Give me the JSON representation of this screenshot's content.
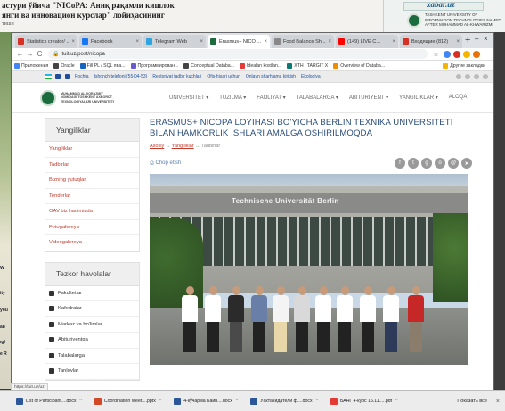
{
  "background": {
    "newspaper_lines": [
      "астури ўйича \"NICoPA: Аниқ рақамли кишлок",
      "янги ва инновацион курслар\" лойиҳасининг",
      "тиши"
    ],
    "brand": "xabar.uz",
    "tuit_caption": "TASHKENT UNIVERSITY OF INFORMATION TECHNOLOGIES NAMED AFTER MUHAMMAD AL-KHWARIZMI",
    "left_fragments": [
      "W",
      "ity",
      "you",
      "ab",
      "ıgl",
      "e R"
    ]
  },
  "browser": {
    "tabs": [
      {
        "label": "Statistics creator/ ...",
        "color": "#d93025"
      },
      {
        "label": "Facebook",
        "color": "#1877f2"
      },
      {
        "label": "Telegram Web",
        "color": "#2ca5e0"
      },
      {
        "label": "Erasmus+ NICO ...",
        "color": "#1a6b3d",
        "active": true
      },
      {
        "label": "Food Balance Sh...",
        "color": "#888888"
      },
      {
        "label": "(149) LIVE C...",
        "color": "#ff0000"
      },
      {
        "label": "Входящие (812)",
        "color": "#d93025"
      }
    ],
    "new_tab": "+",
    "url": "tuit.uz/post/nicopa",
    "bookmarks": [
      {
        "label": "Приложения",
        "color": "#4285f4"
      },
      {
        "label": "Oracle",
        "color": "#444444"
      },
      {
        "label": "Fill PL / SQL ява...",
        "color": "#1565c0"
      },
      {
        "label": "Программирован...",
        "color": "#6a5acd"
      },
      {
        "label": "Conceptual Databa...",
        "color": "#444444"
      },
      {
        "label": "Idealan kostlan...",
        "color": "#e53935"
      },
      {
        "label": "XTH | TARGIT X",
        "color": "#0b7a75"
      },
      {
        "label": "Overview of Databa...",
        "color": "#f28c00"
      }
    ],
    "bookmarks_more": "Другие закладки"
  },
  "site": {
    "topbar": [
      "Pochta",
      "Ishonch telefoni (55-04-53)",
      "Rektoriyat tadbir kuchlari",
      "Ofis-hisari uchun",
      "Onlayn sharhlama kiritish",
      "Ekologiya"
    ],
    "org_name": "MUHAMMAD AL-XORAZMIY NOMIDAGI TOSHKENT AXBOROT TEXNOLOGIYALARI UNIVERSITETI",
    "nav": [
      "UNIVERSITET ▾",
      "TUZILMA ▾",
      "FAOLIYAT ▾",
      "TALABALARGA ▾",
      "ABITURIYENT ▾",
      "YANGILIKLAR ▾",
      "ALOQA"
    ]
  },
  "sidebar": {
    "news_title": "Yangiliklar",
    "news_items": [
      "Yangiliklar",
      "Tadbirlar",
      "Bizning yutuqlar",
      "Tenderlar",
      "OAV biz haqimizda",
      "Fotogalereya",
      "Videogalereya"
    ],
    "links_title": "Tezkor havolalar",
    "link_items": [
      "Fakultetlar",
      "Kafedralar",
      "Markaz va bo'limlar",
      "Abituriyentga",
      "Talabalarga",
      "Tanlovlar"
    ]
  },
  "article": {
    "title": "ERASMUS+ NICOPA LOYIHASI BO'YICHA BERLIN TEXNIKA UNIVERSITETI BILAN HAMKORLIK ISHLARI AMALGA OSHIRILMOQDA",
    "breadcrumb": [
      "Asosiy",
      "Yangiliklar",
      "Tadbirlar"
    ],
    "print_label": "Chop etish",
    "photo_sign": "Technische Universität Berlin"
  },
  "status_url": "https://tuit.uz/uz",
  "taskbar": {
    "items": [
      {
        "label": "List of Participant....docx",
        "color": "#2b579a"
      },
      {
        "label": "Coordination Meet....pptx",
        "color": "#d24726"
      },
      {
        "label": "4-кўчарма Байн....docx",
        "color": "#2b579a"
      },
      {
        "label": "Уактахидатели ф....docx",
        "color": "#2b579a"
      },
      {
        "label": "БАНГ 4-курс 16.11.....pdf",
        "color": "#e53935"
      }
    ],
    "show_all": "Показать все"
  }
}
